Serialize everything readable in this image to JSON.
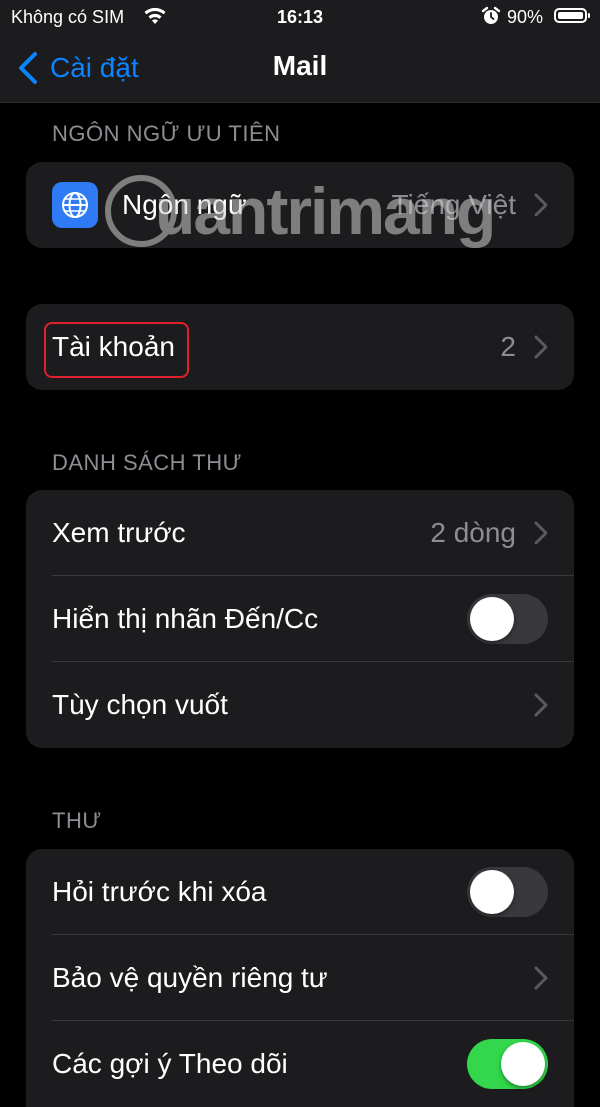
{
  "status_bar": {
    "carrier": "Không có SIM",
    "time": "16:13",
    "battery_percent": "90%",
    "battery_level": 0.9,
    "icons": [
      "wifi-icon",
      "alarm-icon",
      "battery-icon"
    ]
  },
  "nav": {
    "back_label": "Cài đặt",
    "title": "Mail"
  },
  "sections": {
    "preferred_language": {
      "header": "NGÔN NGỮ ƯU TIÊN",
      "language_row": {
        "label": "Ngôn ngữ",
        "value": "Tiếng Việt",
        "icon": "globe-icon"
      }
    },
    "accounts": {
      "accounts_row": {
        "label": "Tài khoản",
        "value": "2"
      }
    },
    "message_list": {
      "header": "DANH SÁCH THƯ",
      "preview_row": {
        "label": "Xem trước",
        "value": "2 dòng"
      },
      "show_to_cc_row": {
        "label": "Hiển thị nhãn Đến/Cc",
        "toggle_on": false
      },
      "swipe_options_row": {
        "label": "Tùy chọn vuốt"
      }
    },
    "messages": {
      "header": "THƯ",
      "ask_before_delete_row": {
        "label": "Hỏi trước khi xóa",
        "toggle_on": false
      },
      "privacy_protection_row": {
        "label": "Bảo vệ quyền riêng tư"
      },
      "follow_up_row": {
        "label": "Các gợi ý Theo dõi",
        "toggle_on": true
      }
    }
  },
  "watermark": {
    "text": "uantrimang"
  },
  "colors": {
    "accent": "#0a84ff",
    "toggle_on": "#32d74b",
    "highlight": "#e0202a",
    "background": "#000000",
    "cell": "#1c1c1e"
  }
}
